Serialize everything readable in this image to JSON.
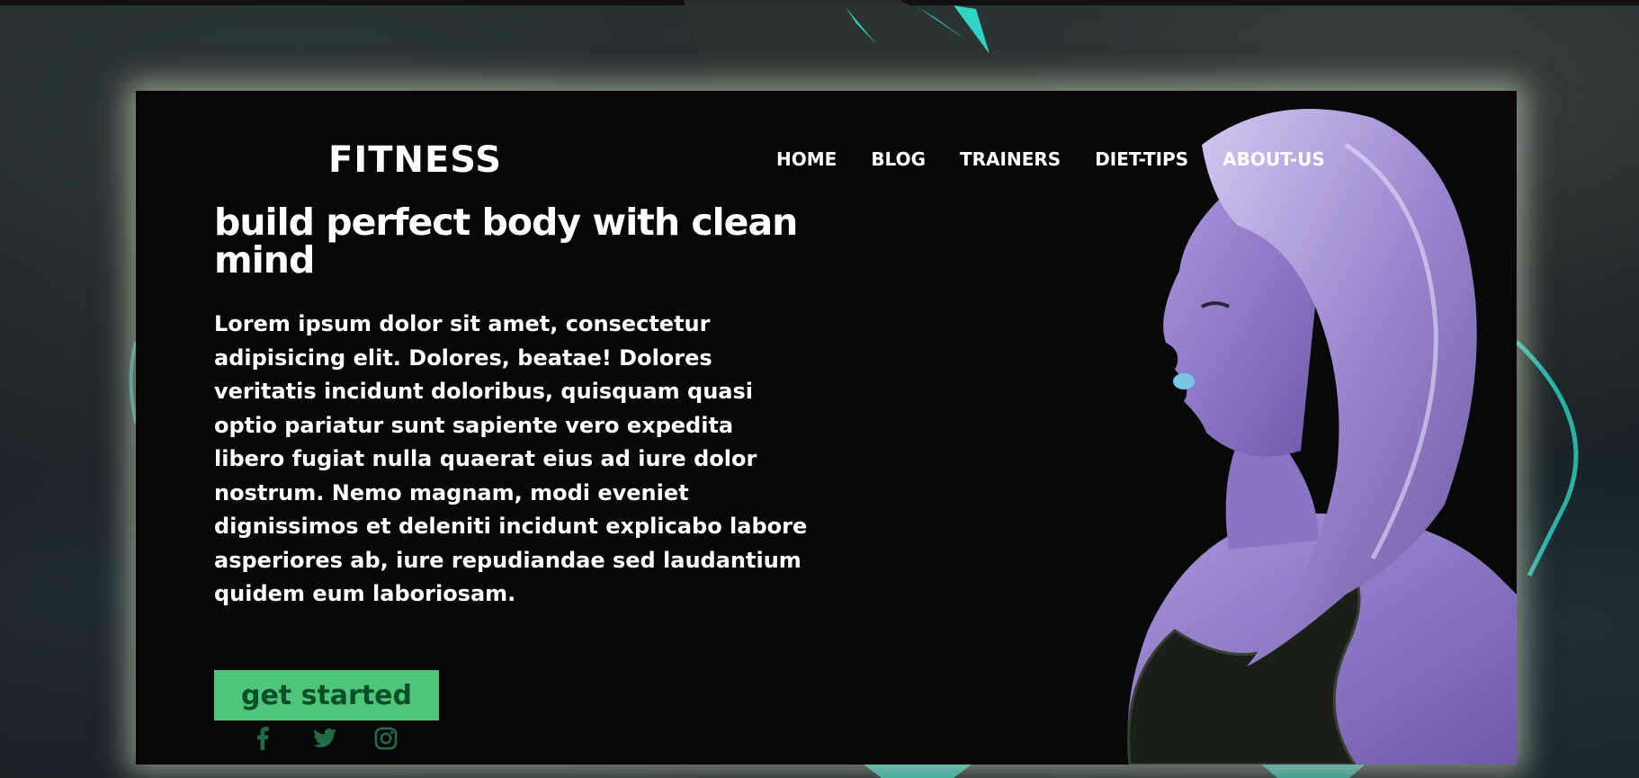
{
  "brand": {
    "logo": "FITNESS"
  },
  "nav": {
    "items": [
      {
        "label": "HOME"
      },
      {
        "label": "BLOG"
      },
      {
        "label": "TRAINERS"
      },
      {
        "label": "DIET-TIPS"
      },
      {
        "label": "ABOUT-US"
      }
    ]
  },
  "hero": {
    "title": "build perfect body with clean mind",
    "body": "Lorem ipsum dolor sit amet, consectetur adipisicing elit. Dolores, beatae! Dolores veritatis incidunt doloribus, quisquam quasi optio pariatur sunt sapiente vero expedita libero fugiat nulla quaerat eius ad iure dolor nostrum. Nemo magnam, modi eveniet dignissimos et deleniti incidunt explicabo labore asperiores ab, iure repudiandae sed laudantium quidem eum laboriosam.",
    "cta_label": "get started"
  },
  "social": {
    "icons": [
      "facebook-icon",
      "twitter-icon",
      "instagram-icon"
    ]
  },
  "colors": {
    "accent": "#4fc57a",
    "accent_text": "#0b4f2a",
    "card_bg": "#070707",
    "text": "#ffffff",
    "photo_tint": "#8c77c8"
  }
}
